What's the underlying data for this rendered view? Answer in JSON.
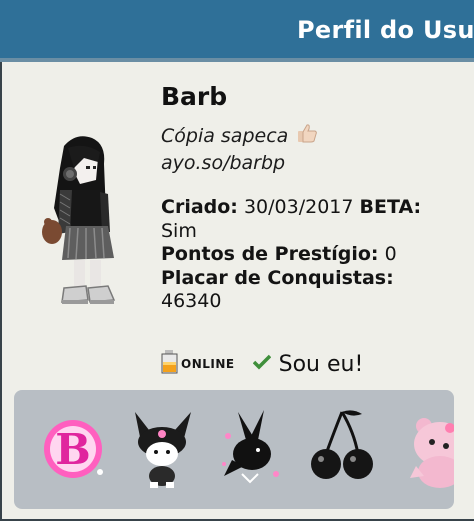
{
  "header": {
    "title": "Perfil do Usu"
  },
  "profile": {
    "name": "Barb",
    "motto": "Cópia sapeca",
    "link": "ayo.so/barbp",
    "created_label": "Criado:",
    "created_value": "30/03/2017",
    "beta_label": "BETA:",
    "beta_value": "Sim",
    "prestige_label": "Pontos de Prestígio:",
    "prestige_value": "0",
    "achievements_label": "Placar de Conquistas:",
    "achievements_value": "46340"
  },
  "status": {
    "online_label": "ONLINE",
    "self_label": "Sou eu!"
  },
  "badges": [
    {
      "icon": "barbie-b-badge-icon"
    },
    {
      "icon": "kuromi-badge-icon"
    },
    {
      "icon": "bunny-logo-badge-icon"
    },
    {
      "icon": "cherries-badge-icon"
    },
    {
      "icon": "pink-bear-badge-icon"
    }
  ],
  "colors": {
    "header_bg": "#2f7098",
    "panel_bg": "#efefe9",
    "badge_bar_bg": "#b8bec4",
    "check_green": "#3f8f3b"
  }
}
